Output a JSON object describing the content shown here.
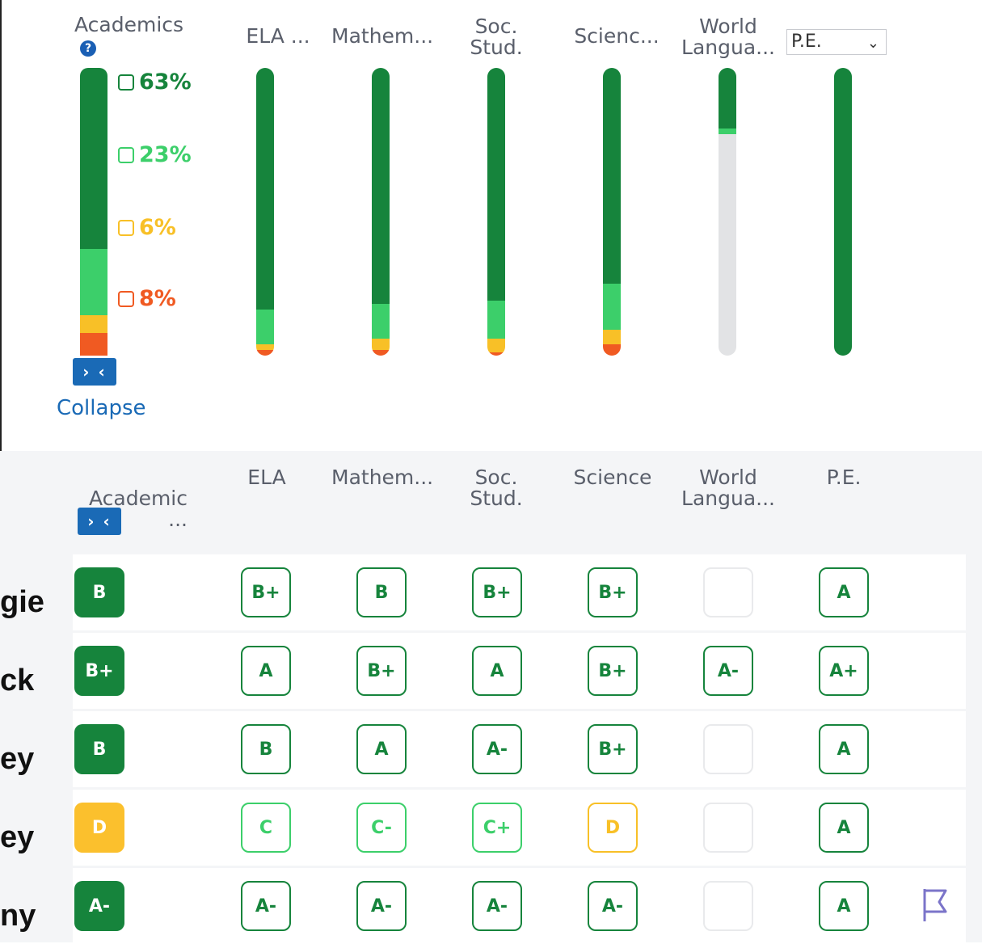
{
  "top": {
    "academics_label": "Academics",
    "help_icon": "?",
    "columns": [
      "ELA ...",
      "Mathem...",
      "Soc.\nStud. ...",
      "Scienc...",
      "World\nLangua...",
      "P.E."
    ],
    "select_value": "P.E.",
    "collapse_label": "Collapse",
    "collapse_glyph": "› ‹",
    "percentages": [
      {
        "value": "63%",
        "color": "#16843c"
      },
      {
        "value": "23%",
        "color": "#3ccf6a"
      },
      {
        "value": "6%",
        "color": "#f8c027"
      },
      {
        "value": "8%",
        "color": "#f05a22"
      }
    ],
    "bar_colors": {
      "dark": "#16843c",
      "light": "#3ccf6a",
      "yellow": "#f8c027",
      "orange": "#f05a22",
      "none": "#e2e3e5"
    },
    "bars": [
      {
        "name": "academics",
        "dark": 63,
        "light": 23,
        "yellow": 6,
        "orange": 8,
        "none": 0
      },
      {
        "name": "ela",
        "dark": 84,
        "light": 12,
        "yellow": 2,
        "orange": 2,
        "none": 0
      },
      {
        "name": "mathematics",
        "dark": 82,
        "light": 12,
        "yellow": 4,
        "orange": 2,
        "none": 0
      },
      {
        "name": "social-studies",
        "dark": 81,
        "light": 13,
        "yellow": 5,
        "orange": 1,
        "none": 0
      },
      {
        "name": "science",
        "dark": 75,
        "light": 16,
        "yellow": 5,
        "orange": 4,
        "none": 0
      },
      {
        "name": "world-language",
        "dark": 21,
        "light": 2,
        "yellow": 0,
        "orange": 0,
        "none": 77
      },
      {
        "name": "pe",
        "dark": 100,
        "light": 0,
        "yellow": 0,
        "orange": 0,
        "none": 0
      }
    ]
  },
  "table": {
    "headers": [
      "Academic\n...",
      "ELA",
      "Mathem...",
      "Soc.\nStud.",
      "Science",
      "World\nLangua...",
      "P.E."
    ],
    "collapse_glyph": "› ‹",
    "rows": [
      {
        "name": "gie",
        "overall": "B",
        "overall_style": "fill-dark",
        "grades": [
          [
            "B+",
            "dark"
          ],
          [
            "B",
            "dark"
          ],
          [
            "B+",
            "dark"
          ],
          [
            "B+",
            "dark"
          ],
          [
            "",
            "empty"
          ],
          [
            "A",
            "dark"
          ]
        ]
      },
      {
        "name": "ck",
        "overall": "B+",
        "overall_style": "fill-dark",
        "grades": [
          [
            "A",
            "dark"
          ],
          [
            "B+",
            "dark"
          ],
          [
            "A",
            "dark"
          ],
          [
            "B+",
            "dark"
          ],
          [
            "A-",
            "dark"
          ],
          [
            "A+",
            "dark"
          ]
        ]
      },
      {
        "name": "ey",
        "overall": "B",
        "overall_style": "fill-dark",
        "grades": [
          [
            "B",
            "dark"
          ],
          [
            "A",
            "dark"
          ],
          [
            "A-",
            "dark"
          ],
          [
            "B+",
            "dark"
          ],
          [
            "",
            "empty"
          ],
          [
            "A",
            "dark"
          ]
        ]
      },
      {
        "name": "ey",
        "overall": "D",
        "overall_style": "fill-yellow",
        "grades": [
          [
            "C",
            "light"
          ],
          [
            "C-",
            "light"
          ],
          [
            "C+",
            "light"
          ],
          [
            "D",
            "yellow"
          ],
          [
            "",
            "empty"
          ],
          [
            "A",
            "dark"
          ]
        ]
      },
      {
        "name": "ny",
        "overall": "A-",
        "overall_style": "fill-dark",
        "grades": [
          [
            "A-",
            "dark"
          ],
          [
            "A-",
            "dark"
          ],
          [
            "A-",
            "dark"
          ],
          [
            "A-",
            "dark"
          ],
          [
            "",
            "empty"
          ],
          [
            "A",
            "dark"
          ]
        ]
      }
    ],
    "flag_icon": "flag-icon"
  }
}
